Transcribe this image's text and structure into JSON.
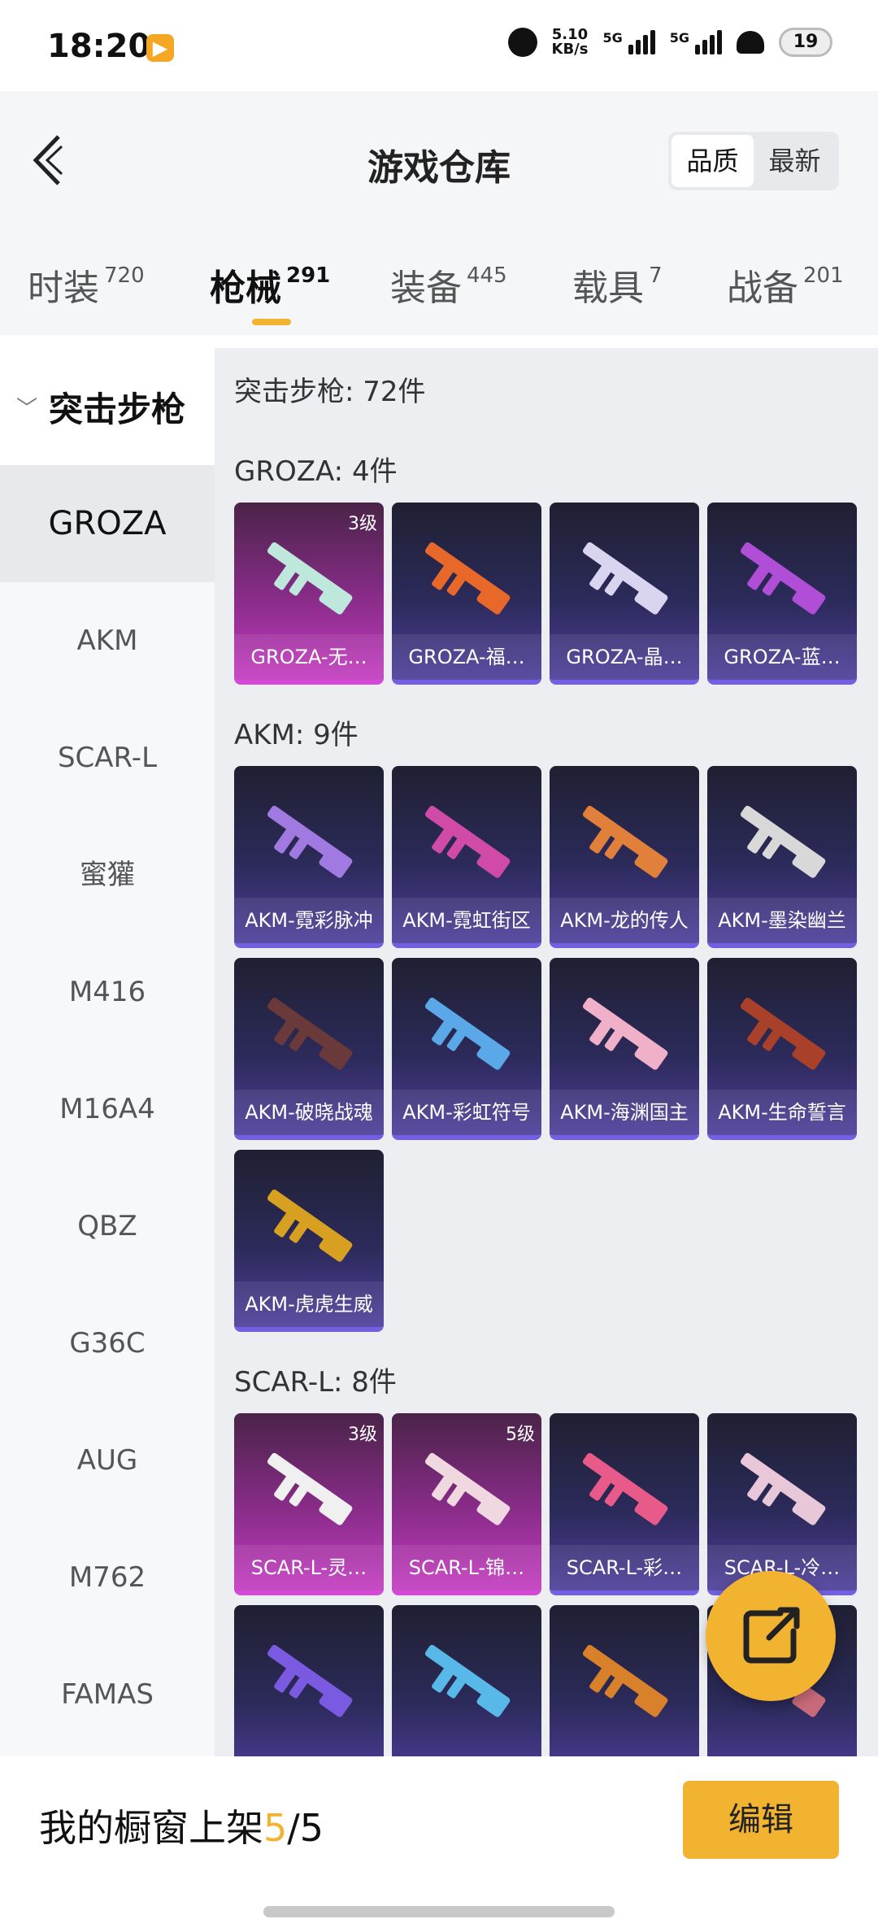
{
  "status": {
    "time": "18:20",
    "speed": "5.10",
    "speed_unit": "KB/s",
    "net1": "5G",
    "net2": "5G",
    "battery": "19"
  },
  "header": {
    "title": "游戏仓库",
    "sort": [
      "品质",
      "最新"
    ]
  },
  "tabs": [
    {
      "label": "时装",
      "count": "720"
    },
    {
      "label": "枪械",
      "count": "291"
    },
    {
      "label": "装备",
      "count": "445"
    },
    {
      "label": "载具",
      "count": "7"
    },
    {
      "label": "战备",
      "count": "201"
    }
  ],
  "sidebar": {
    "category": "突击步枪",
    "items": [
      "GROZA",
      "AKM",
      "SCAR-L",
      "蜜獾",
      "M416",
      "M16A4",
      "QBZ",
      "G36C",
      "AUG",
      "M762",
      "FAMAS"
    ]
  },
  "main": {
    "summary": "突击步枪: 72件",
    "sections": [
      {
        "title": "GROZA: 4件",
        "items": [
          {
            "name": "GROZA-无…",
            "level": "3级",
            "tone": "pink",
            "color": "#bfe8dd"
          },
          {
            "name": "GROZA-福…",
            "tone": "blue",
            "color": "#e8682a"
          },
          {
            "name": "GROZA-晶…",
            "tone": "blue",
            "color": "#d9d4f0"
          },
          {
            "name": "GROZA-蓝…",
            "tone": "blue",
            "color": "#b04ed8"
          }
        ]
      },
      {
        "title": "AKM: 9件",
        "items": [
          {
            "name": "AKM-霓彩脉冲",
            "tone": "blue",
            "color": "#a07ae0"
          },
          {
            "name": "AKM-霓虹街区",
            "tone": "blue",
            "color": "#d04aa8"
          },
          {
            "name": "AKM-龙的传人",
            "tone": "blue",
            "color": "#e0803a"
          },
          {
            "name": "AKM-墨染幽兰",
            "tone": "blue",
            "color": "#d8d8d8"
          },
          {
            "name": "AKM-破晓战魂",
            "tone": "blue",
            "color": "#6a3a3a"
          },
          {
            "name": "AKM-彩虹符号",
            "tone": "blue",
            "color": "#5aa8e8"
          },
          {
            "name": "AKM-海渊国主",
            "tone": "blue",
            "color": "#f0b0c8"
          },
          {
            "name": "AKM-生命誓言",
            "tone": "blue",
            "color": "#a8402a"
          },
          {
            "name": "AKM-虎虎生威",
            "tone": "blue",
            "color": "#d8a020"
          }
        ]
      },
      {
        "title": "SCAR-L: 8件",
        "items": [
          {
            "name": "SCAR-L-灵…",
            "level": "3级",
            "tone": "pink",
            "color": "#f0f0f0"
          },
          {
            "name": "SCAR-L-锦…",
            "level": "5级",
            "tone": "pink",
            "color": "#f0d8e0"
          },
          {
            "name": "SCAR-L-彩…",
            "tone": "blue",
            "color": "#e85a8a"
          },
          {
            "name": "SCAR-L-冷…",
            "tone": "blue",
            "color": "#e8c8d8"
          },
          {
            "name": "",
            "tone": "blue",
            "color": "#7a5ae0"
          },
          {
            "name": "",
            "tone": "blue",
            "color": "#58b8e8"
          },
          {
            "name": "",
            "tone": "blue",
            "color": "#d8802a"
          },
          {
            "name": "",
            "tone": "blue",
            "color": "#c86a7a"
          }
        ]
      }
    ]
  },
  "bottom": {
    "label": "我的橱窗上架",
    "current": "5",
    "total": "/5",
    "edit_label": "编辑"
  }
}
